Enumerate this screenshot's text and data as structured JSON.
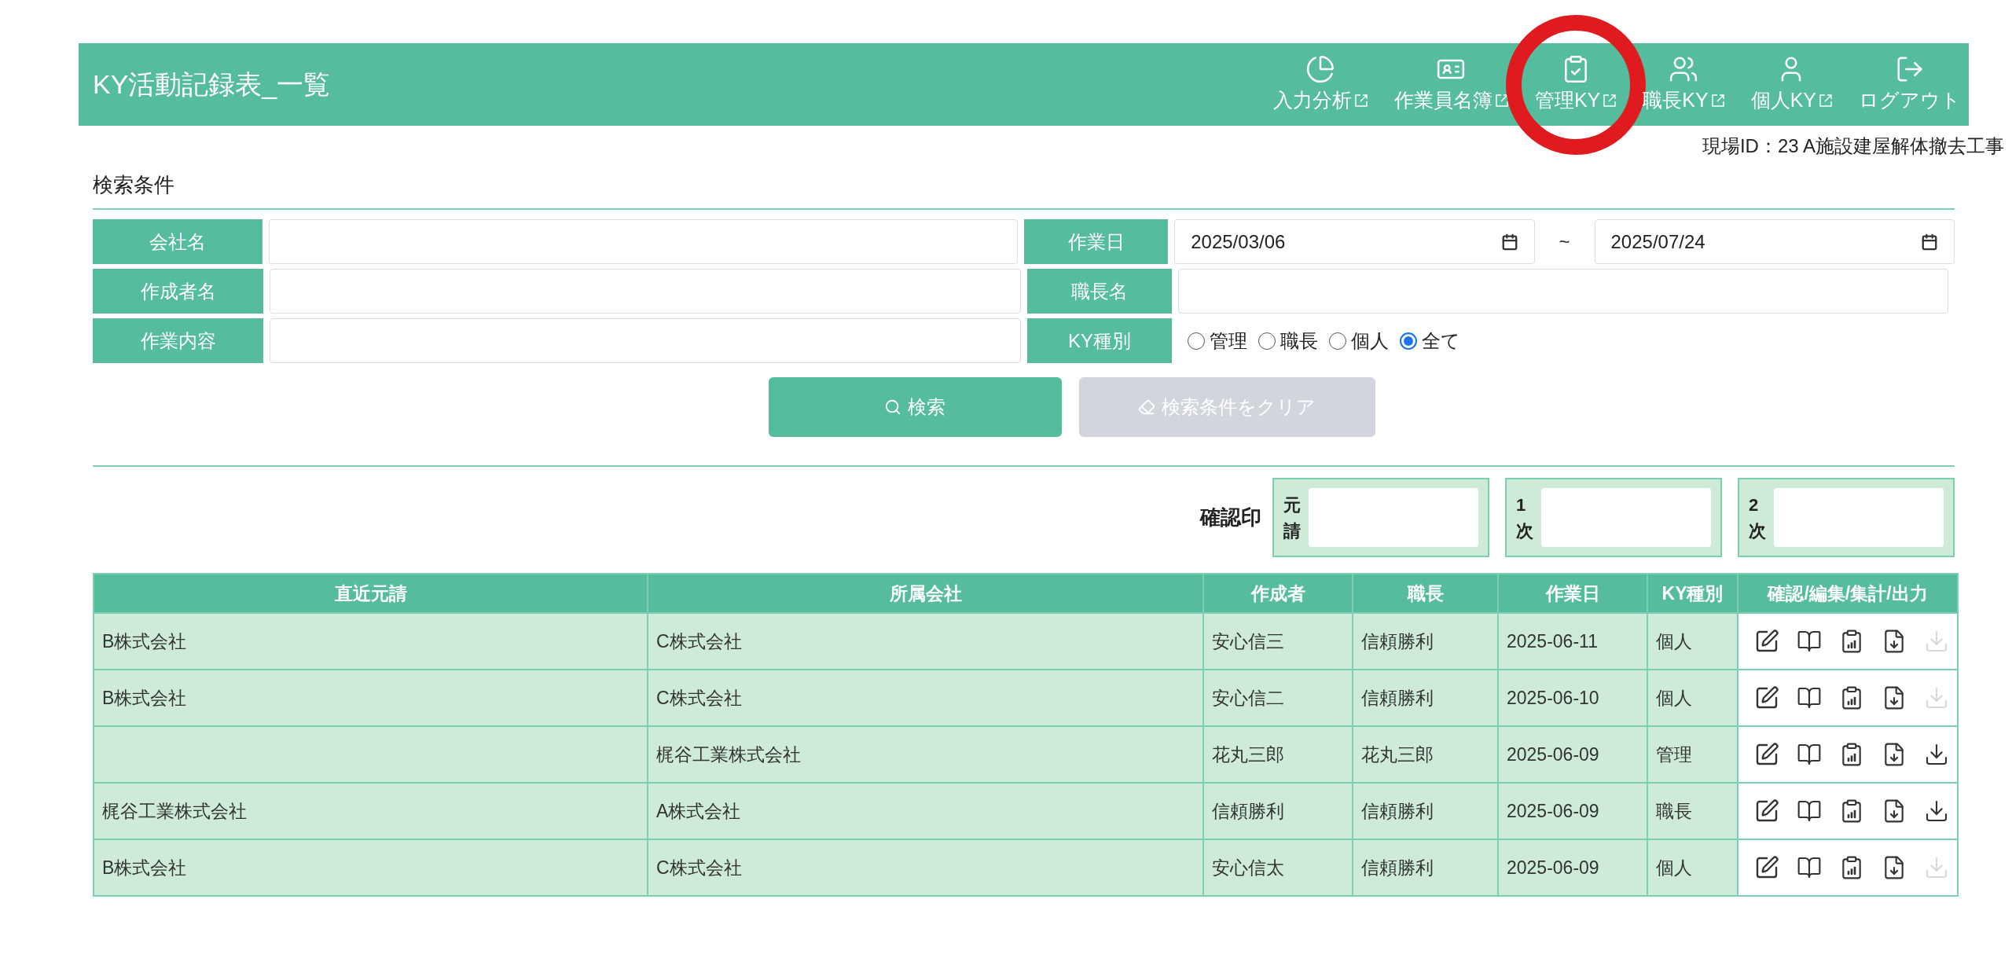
{
  "header": {
    "title": "KY活動記録表_一覧",
    "nav": [
      {
        "kind": "pie",
        "label": "入力分析",
        "external": true,
        "circled": false
      },
      {
        "kind": "idcard",
        "label": "作業員名簿",
        "external": true,
        "circled": false
      },
      {
        "kind": "clipboard",
        "label": "管理KY",
        "external": true,
        "circled": true
      },
      {
        "kind": "users",
        "label": "職長KY",
        "external": true,
        "circled": false
      },
      {
        "kind": "user",
        "label": "個人KY",
        "external": true,
        "circled": false
      },
      {
        "kind": "logout",
        "label": "ログアウト",
        "external": false,
        "circled": false
      }
    ],
    "site": "現場ID：23 A施設建屋解体撤去工事"
  },
  "search": {
    "heading": "検索条件",
    "company": {
      "label": "会社名"
    },
    "author": {
      "label": "作成者名"
    },
    "work": {
      "label": "作業内容"
    },
    "date": {
      "label": "作業日",
      "from": "2025/03/06",
      "separator": "~",
      "to": "2025/07/24"
    },
    "foreman": {
      "label": "職長名"
    },
    "ky_type": {
      "label": "KY種別",
      "options": [
        {
          "label": "管理",
          "selected": false
        },
        {
          "label": "職長",
          "selected": false
        },
        {
          "label": "個人",
          "selected": false
        },
        {
          "label": "全て",
          "selected": true
        }
      ]
    },
    "search_button": "検索",
    "clear_button": {
      "label": "検索条件をクリア",
      "disabled": true
    }
  },
  "stamps": {
    "label": "確認印",
    "boxes": [
      {
        "label": "元請"
      },
      {
        "label": "1次"
      },
      {
        "label": "2次"
      }
    ]
  },
  "table": {
    "columns": [
      "直近元請",
      "所属会社",
      "作成者",
      "職長",
      "作業日",
      "KY種別",
      "確認/編集/集計/出力"
    ],
    "rows": [
      {
        "cells": [
          "B株式会社",
          "C株式会社",
          "安心信三",
          "信頼勝利",
          "2025-06-11",
          "個人"
        ],
        "download_enabled": false
      },
      {
        "cells": [
          "B株式会社",
          "C株式会社",
          "安心信二",
          "信頼勝利",
          "2025-06-10",
          "個人"
        ],
        "download_enabled": false
      },
      {
        "cells": [
          "",
          "梶谷工業株式会社",
          "花丸三郎",
          "花丸三郎",
          "2025-06-09",
          "管理"
        ],
        "download_enabled": true
      },
      {
        "cells": [
          "梶谷工業株式会社",
          "A株式会社",
          "信頼勝利",
          "信頼勝利",
          "2025-06-09",
          "職長"
        ],
        "download_enabled": true
      },
      {
        "cells": [
          "B株式会社",
          "C株式会社",
          "安心信太",
          "信頼勝利",
          "2025-06-09",
          "個人"
        ],
        "download_enabled": false
      }
    ]
  }
}
